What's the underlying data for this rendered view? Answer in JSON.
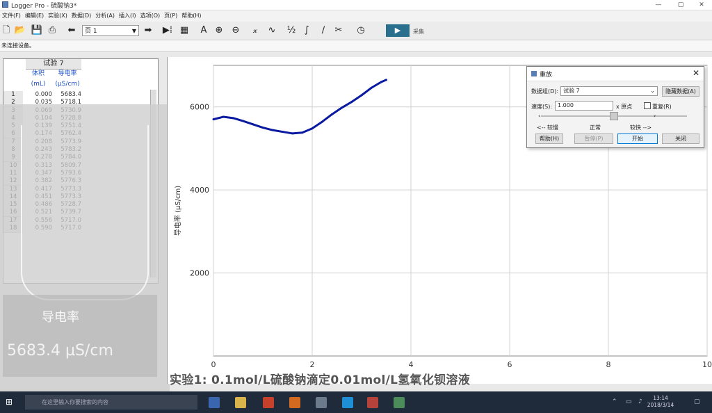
{
  "window": {
    "title": "Logger Pro - 硫酸钠3*",
    "controls": [
      "—",
      "▢",
      "✕"
    ]
  },
  "menu": [
    "文件(F)",
    "编辑(E)",
    "实验(X)",
    "数据(D)",
    "分析(A)",
    "插入(I)",
    "选项(O)",
    "页(P)",
    "帮助(H)"
  ],
  "toolbar": {
    "page_select": "页 1",
    "play_label": "▶",
    "collect_label": "采集"
  },
  "status": "未连接设备。",
  "table": {
    "run": "试验 7",
    "columns": [
      {
        "name": "体积",
        "unit": "(mL)"
      },
      {
        "name": "导电率",
        "unit": "(µS/cm)"
      }
    ],
    "rows": [
      [
        "1",
        "0.000",
        "5683.4"
      ],
      [
        "2",
        "0.035",
        "5718.1"
      ],
      [
        "3",
        "0.069",
        "5730.9"
      ],
      [
        "4",
        "0.104",
        "5728.8"
      ],
      [
        "5",
        "0.139",
        "5751.4"
      ],
      [
        "6",
        "0.174",
        "5762.4"
      ],
      [
        "7",
        "0.208",
        "5773.9"
      ],
      [
        "8",
        "0.243",
        "5783.2"
      ],
      [
        "9",
        "0.278",
        "5784.0"
      ],
      [
        "10",
        "0.313",
        "5809.7"
      ],
      [
        "11",
        "0.347",
        "5793.6"
      ],
      [
        "12",
        "0.382",
        "5776.3"
      ],
      [
        "13",
        "0.417",
        "5773.3"
      ],
      [
        "14",
        "0.451",
        "5773.3"
      ],
      [
        "15",
        "0.486",
        "5728.7"
      ],
      [
        "16",
        "0.521",
        "5739.7"
      ],
      [
        "17",
        "0.556",
        "5717.0"
      ],
      [
        "18",
        "0.590",
        "5717.0"
      ]
    ]
  },
  "meter": {
    "name": "导电率",
    "value": "5683.4 µS/cm"
  },
  "caption": "实验1: 0.1mol/L硫酸钠滴定0.01mol/L氢氧化钡溶液",
  "dialog": {
    "title": "重放",
    "dataset_label": "数据组(D):",
    "dataset_value": "试验 7",
    "hide_button": "隐藏数据(A)",
    "speed_label": "速度(S):",
    "speed_value": "1.000",
    "speed_unit": "x 原点",
    "repeat_label": "重复(R)",
    "slow_label": "<-- 较慢",
    "normal_label": "正常",
    "fast_label": "较快 -->",
    "help_button": "帮助(H)",
    "pause_button": "暂停(P)",
    "start_button": "开始",
    "close_button": "关闭",
    "slider_position": 0.5
  },
  "taskbar": {
    "search_placeholder": "在这里输入你要搜索的内容",
    "time": "13:14",
    "date": "2018/3/14",
    "tray_badge": "23H"
  },
  "colors": {
    "curve": "#0a1aa0",
    "grid": "#d0d0d0",
    "accent": "#2b6f8f"
  },
  "chart_data": {
    "type": "line",
    "xlabel": "",
    "ylabel": "导电率 (µS/cm)",
    "xlim": [
      0,
      10
    ],
    "ylim": [
      0,
      7000
    ],
    "xticks": [
      0,
      2,
      4,
      6,
      8,
      10
    ],
    "yticks": [
      2000,
      4000,
      6000
    ],
    "grid": true,
    "series": [
      {
        "x": [
          0.0,
          0.2,
          0.4,
          0.6,
          0.8,
          1.0,
          1.2,
          1.4,
          1.6,
          1.8,
          2.0,
          2.2,
          2.4,
          2.6,
          2.8,
          3.0,
          3.2,
          3.4,
          3.5
        ],
        "y": [
          5700,
          5760,
          5730,
          5660,
          5580,
          5500,
          5440,
          5400,
          5360,
          5380,
          5480,
          5640,
          5820,
          5980,
          6120,
          6280,
          6460,
          6600,
          6650
        ]
      }
    ]
  }
}
